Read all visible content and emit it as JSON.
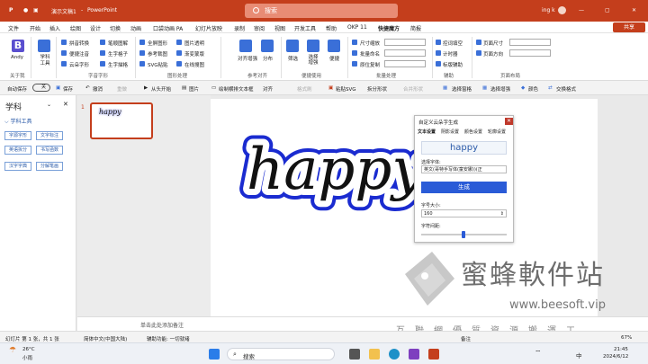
{
  "titlebar": {
    "filename": "演示文稿1",
    "sep": "-",
    "app": "PowerPoint",
    "search": "搜索",
    "user": "ing k"
  },
  "menu": [
    "文件",
    "开始",
    "插入",
    "绘图",
    "设计",
    "切换",
    "动画",
    "口袋动画 PA",
    "幻灯片放映",
    "录制",
    "审阅",
    "视图",
    "开发工具",
    "帮助",
    "OKP 11",
    "快捷魔方",
    "简报"
  ],
  "menu_active": "快捷魔方",
  "share": "共享",
  "ribbon": {
    "andy": "Andy",
    "about_group": "关于我",
    "xueke": "学科\n工具",
    "zifu": [
      "拼音转换",
      "笔顺图解",
      "便捷注音",
      "生字格子",
      "云朵字形",
      "生字描格"
    ],
    "zifu_group": "字音字形",
    "tuxing": [
      "全屏图形",
      "图片透明",
      "参考裁图",
      "渐变蒙版",
      "SVG粘贴",
      "在线搜图"
    ],
    "tuxing_group": "图形处理",
    "duiqi": [
      "对齐增强",
      "分布"
    ],
    "duiqi_group": "参考对齐",
    "bianjie": [
      "筛选",
      "选择增强",
      "便捷"
    ],
    "bianjie_group": "便捷使用",
    "piliang": [
      "尺寸缩放",
      "批量命名",
      "原位复制"
    ],
    "piliang_group": "批量处理",
    "fuzhu": [
      "控词填空",
      "计时器",
      "标版辅助"
    ],
    "fuzhu_group": "辅助",
    "page": [
      "页面尺寸",
      "页面方向"
    ],
    "page_group": "页面布局"
  },
  "quickbar": {
    "autosave": "自动保存",
    "off": "关",
    "items": [
      "保存",
      "撤消",
      "重做",
      "从头开始",
      "图片",
      "绘制横排文本框",
      "对齐",
      "格式刷",
      "粘贴SVG",
      "拆分形状",
      "合并形状",
      "选择窗格",
      "选择增强",
      "颜色",
      "交换格式"
    ]
  },
  "leftpane": {
    "title": "学科",
    "section": "学科工具",
    "buttons": [
      "字源字形",
      "文字标注",
      "英语拆分",
      "书写函数",
      "汉字字典",
      "分解笔画"
    ]
  },
  "thumb": {
    "index": "1",
    "text": "happy"
  },
  "slide": {
    "text": "happy"
  },
  "notes": "单击此处添加备注",
  "dialog": {
    "title": "自定义云朵字生成",
    "tabs": [
      "文本设置",
      "阴影设置",
      "颜色设置",
      "轮廓设置"
    ],
    "preview": "happy",
    "font_label": "选择字体:",
    "font_value": "英文(哥特手写体(童安娜))(正",
    "generate": "生成",
    "size_label": "字号大小:",
    "size_value": "160",
    "spacing_label": "字符间距:",
    "spacing_level": 0.48
  },
  "status": {
    "slide": "幻灯片 第 1 张，共 1 张",
    "lang": "简体中文(中国大陆)",
    "access": "辅助功能: 一切就绪",
    "notes": "备注",
    "zoom": "67%"
  },
  "taskbar": {
    "weather_temp": "26°C",
    "weather_desc": "小雨",
    "search": "搜索",
    "time": "21:45",
    "date": "2024/6/12",
    "lang": "中"
  },
  "watermark": {
    "brand": "蜜蜂軟件站",
    "url": "www.beesoft.vip",
    "slogan": "互聯網優質資源搬運工"
  }
}
